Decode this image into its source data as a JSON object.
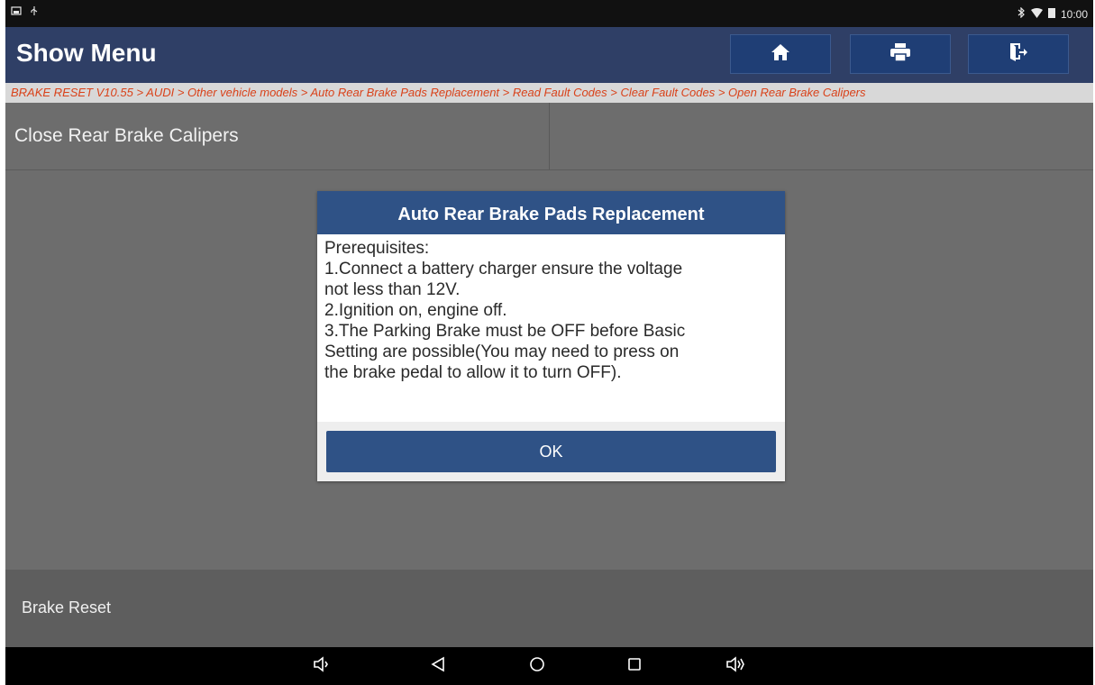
{
  "status_bar": {
    "time": "10:00",
    "left_icons": [
      "gallery-icon",
      "usb-icon"
    ],
    "right_icons": [
      "bluetooth-icon",
      "wifi-icon",
      "battery-icon"
    ]
  },
  "header": {
    "title": "Show Menu",
    "buttons": [
      "home-icon",
      "print-icon",
      "exit-icon"
    ]
  },
  "breadcrumb": "BRAKE RESET V10.55 > AUDI > Other vehicle models > Auto Rear Brake Pads Replacement > Read Fault Codes > Clear Fault Codes > Open Rear Brake Calipers",
  "menu": {
    "items": [
      {
        "label": "Close Rear Brake Calipers"
      },
      {
        "label": ""
      }
    ]
  },
  "dialog": {
    "title": "Auto Rear Brake Pads Replacement",
    "lines": [
      "Prerequisites:",
      "1.Connect a battery charger ensure the voltage",
      "not less than 12V.",
      "2.Ignition on, engine off.",
      "3.The Parking Brake must be OFF before Basic",
      "Setting are possible(You may need to press on",
      "the brake pedal to allow it to turn OFF)."
    ],
    "ok_label": "OK"
  },
  "footer": {
    "label": "Brake Reset"
  },
  "nav_bar": {
    "buttons": [
      "volume-down-icon",
      "back-icon",
      "home-circle-icon",
      "recents-icon",
      "volume-up-icon"
    ]
  },
  "colors": {
    "header_bg": "#2f3f66",
    "dialog_accent": "#2f5286",
    "breadcrumb_text": "#d9421a",
    "screen_bg": "#6d6d6d"
  }
}
